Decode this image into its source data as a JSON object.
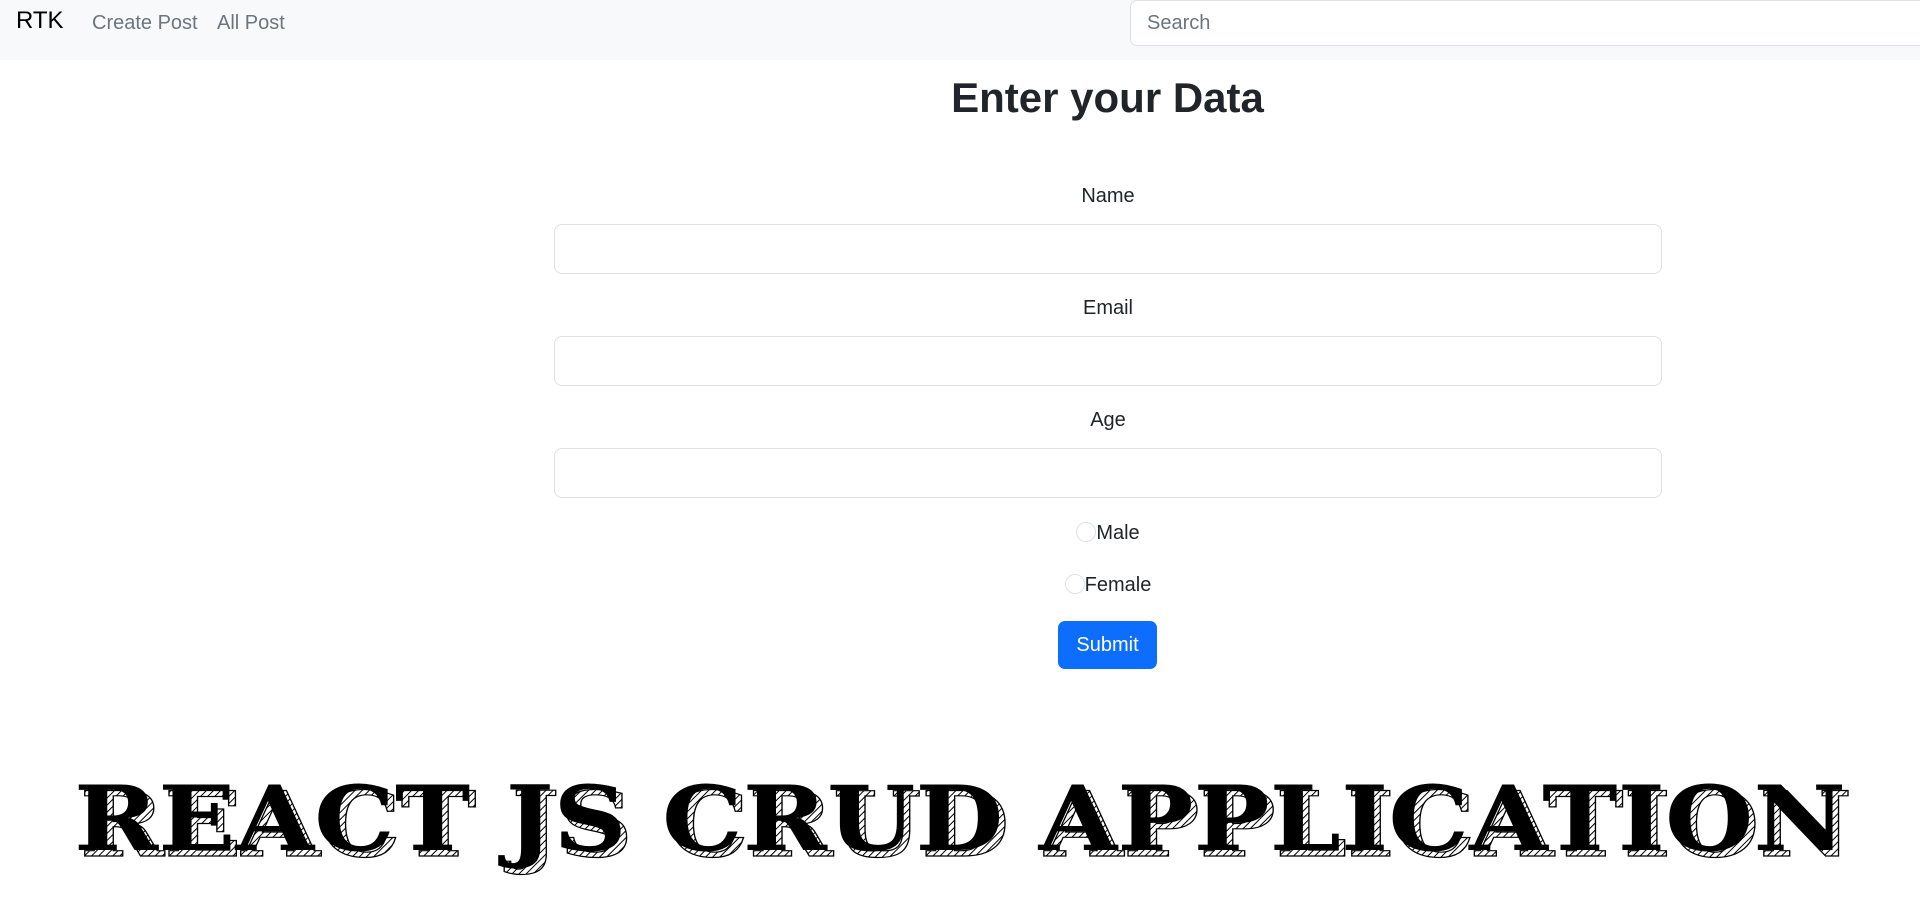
{
  "navbar": {
    "brand": "RTK",
    "links": [
      "Create Post",
      "All Post"
    ],
    "search_placeholder": "Search"
  },
  "form": {
    "title": "Enter your Data",
    "fields": [
      "Name",
      "Email",
      "Age"
    ],
    "gender_options": [
      "Male",
      "Female"
    ],
    "submit_label": "Submit"
  },
  "banner": {
    "text": "REACT JS CRUD APPLICATION"
  },
  "colors": {
    "navbar_bg": "#f8f9fa",
    "primary": "#0d6efd",
    "text": "#212529",
    "muted": "#6c757d"
  }
}
